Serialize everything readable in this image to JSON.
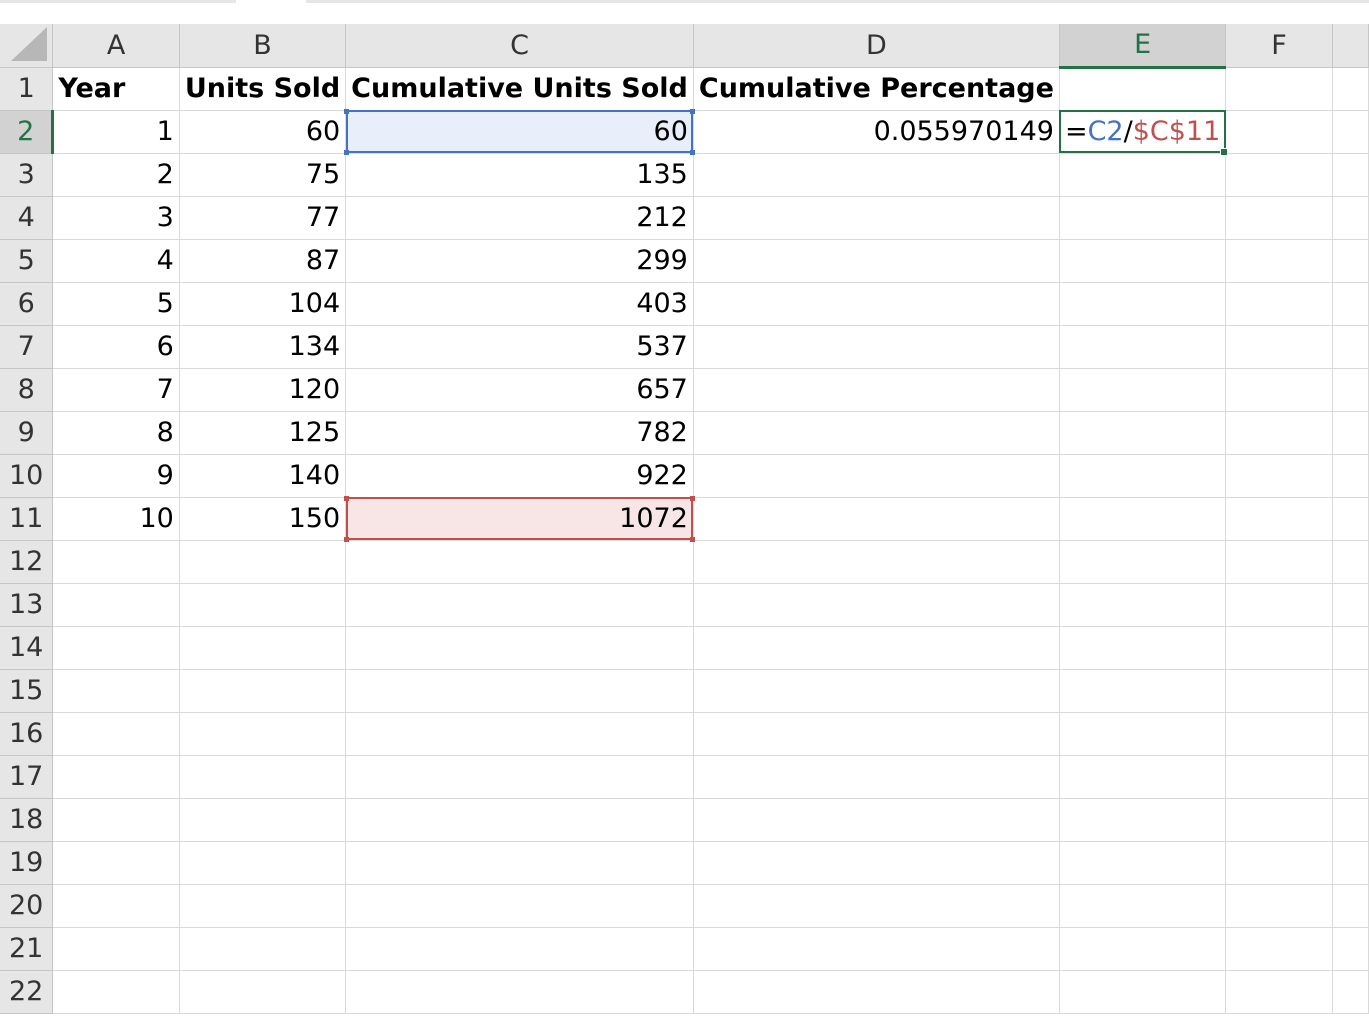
{
  "columns": [
    "A",
    "B",
    "C",
    "D",
    "E",
    "F"
  ],
  "selected_column": "E",
  "header_row": {
    "row": "1",
    "A": "Year",
    "B": "Units Sold",
    "C": "Cumulative Units Sold",
    "D": "Cumulative Percentage"
  },
  "data_rows": [
    {
      "row": "2",
      "A": "1",
      "B": "60",
      "C": "60",
      "D": "0.055970149"
    },
    {
      "row": "3",
      "A": "2",
      "B": "75",
      "C": "135"
    },
    {
      "row": "4",
      "A": "3",
      "B": "77",
      "C": "212"
    },
    {
      "row": "5",
      "A": "4",
      "B": "87",
      "C": "299"
    },
    {
      "row": "6",
      "A": "5",
      "B": "104",
      "C": "403"
    },
    {
      "row": "7",
      "A": "6",
      "B": "134",
      "C": "537"
    },
    {
      "row": "8",
      "A": "7",
      "B": "120",
      "C": "657"
    },
    {
      "row": "9",
      "A": "8",
      "B": "125",
      "C": "782"
    },
    {
      "row": "10",
      "A": "9",
      "B": "140",
      "C": "922"
    },
    {
      "row": "11",
      "A": "10",
      "B": "150",
      "C": "1072"
    }
  ],
  "empty_rows": [
    "12",
    "13",
    "14",
    "15",
    "16",
    "17",
    "18",
    "19",
    "20",
    "21",
    "22"
  ],
  "active_cell": {
    "address": "E2",
    "formula_parts": [
      "=",
      "C2",
      "/",
      "$C$11"
    ]
  },
  "colors": {
    "ref_blue": "#4472c4",
    "ref_red": "#c0504d",
    "selection_green": "#217346"
  }
}
